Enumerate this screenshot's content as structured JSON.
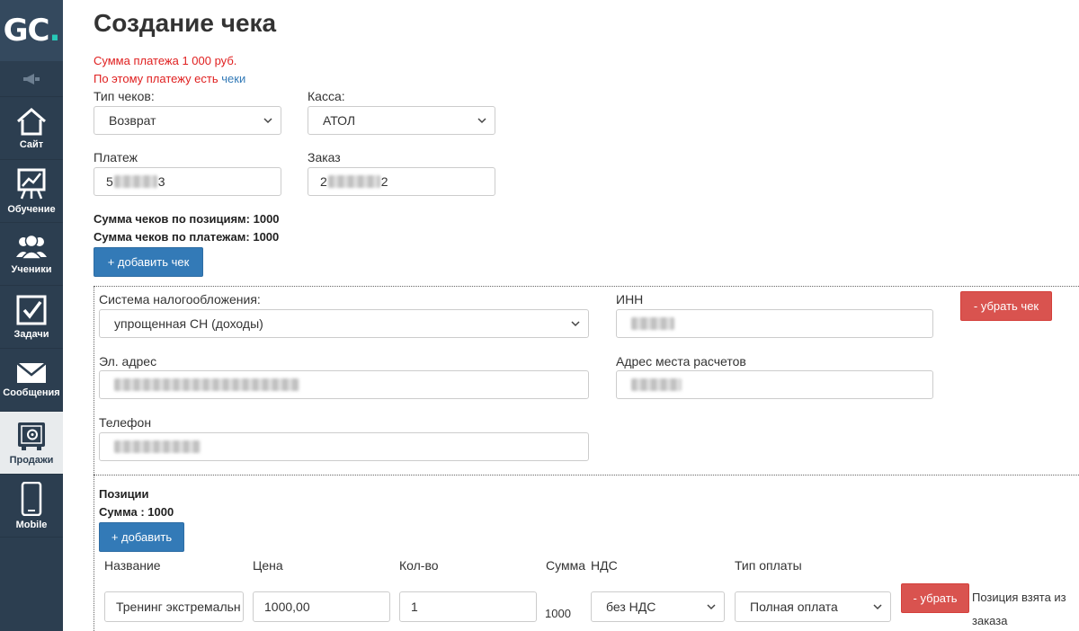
{
  "sidebar": {
    "logo_text": "GC",
    "logo_dot": ".",
    "items": [
      {
        "label": "Сайт",
        "icon": "house-icon"
      },
      {
        "label": "Обучение",
        "icon": "presentation-chart-icon"
      },
      {
        "label": "Ученики",
        "icon": "users-icon"
      },
      {
        "label": "Задачи",
        "icon": "checkbox-icon"
      },
      {
        "label": "Сообщения",
        "icon": "envelope-icon"
      },
      {
        "label": "Продажи",
        "icon": "safe-icon"
      },
      {
        "label": "Mobile",
        "icon": "smartphone-icon"
      }
    ],
    "active_index": 5
  },
  "page": {
    "title": "Создание чека",
    "payment_sum_msg": "Сумма платежа 1 000 руб.",
    "checks_msg_prefix": "По этому платежу есть",
    "checks_link": "чеки"
  },
  "form": {
    "check_type_label": "Тип чеков:",
    "check_type_value": "Возврат",
    "cashbox_label": "Касса:",
    "cashbox_value": "АТОЛ",
    "payment_label": "Платеж",
    "payment_value_start": "5",
    "payment_value_end": "3",
    "order_label": "Заказ",
    "order_value_start": "2",
    "order_value_end": "2",
    "sum_by_positions": "Сумма чеков по позициям: 1000",
    "sum_by_payments": "Сумма чеков по платежам: 1000",
    "add_check_btn": "+ добавить чек"
  },
  "check": {
    "tax_label": "Система налогообложения:",
    "tax_value": "упрощенная СН (доходы)",
    "inn_label": "ИНН",
    "remove_check_btn": "- убрать чек",
    "email_label": "Эл. адрес",
    "address_label": "Адрес места расчетов",
    "phone_label": "Телефон",
    "positions_title": "Позиции",
    "positions_sum": "Сумма : 1000",
    "add_position_btn": "+ добавить",
    "columns": {
      "name": "Название",
      "price": "Цена",
      "qty": "Кол-во",
      "sum": "Сумма",
      "vat": "НДС",
      "pay_type": "Тип оплаты"
    },
    "position": {
      "name": "Тренинг экстремальн",
      "price": "1000,00",
      "qty": "1",
      "sum": "1000",
      "vat": "без НДС",
      "pay_type": "Полная оплата",
      "remove_btn": "- убрать",
      "note": "Позиция взята из заказа"
    }
  },
  "colors": {
    "sidebar_bg": "#2c3e50",
    "primary": "#337ab7",
    "danger": "#d9534f",
    "alert_text": "#e02020",
    "logo_accent": "#27c9b8"
  }
}
